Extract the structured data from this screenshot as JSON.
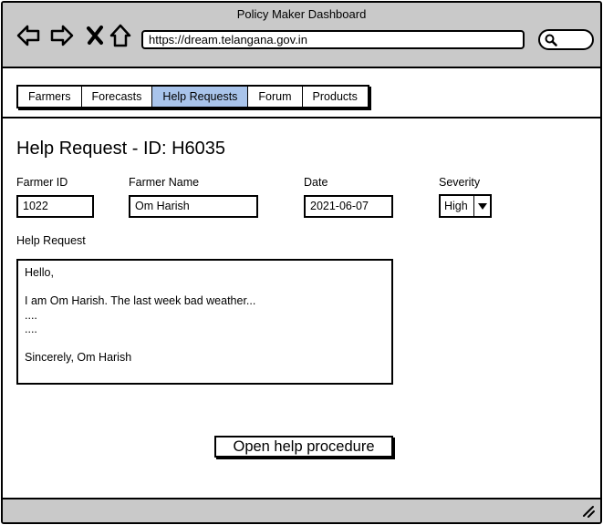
{
  "window": {
    "title": "Policy Maker Dashboard"
  },
  "browser": {
    "url": "https://dream.telangana.gov.in",
    "icons": [
      "back-arrow-icon",
      "forward-arrow-icon",
      "close-icon",
      "home-icon",
      "search-icon"
    ]
  },
  "tabs": [
    {
      "label": "Farmers",
      "active": false
    },
    {
      "label": "Forecasts",
      "active": false
    },
    {
      "label": "Help Requests",
      "active": true
    },
    {
      "label": "Forum",
      "active": false
    },
    {
      "label": "Products",
      "active": false
    }
  ],
  "page": {
    "title": "Help Request - ID: H6035"
  },
  "form": {
    "farmer_id": {
      "label": "Farmer ID",
      "value": "1022"
    },
    "farmer_name": {
      "label": "Farmer Name",
      "value": "Om Harish"
    },
    "date": {
      "label": "Date",
      "value": "2021-06-07"
    },
    "severity": {
      "label": "Severity",
      "value": "High"
    },
    "help_request": {
      "label": "Help Request",
      "lines": [
        "Hello,",
        "",
        "I am Om Harish. The last week bad weather...",
        "....",
        "....",
        "",
        "Sincerely, Om Harish"
      ]
    }
  },
  "actions": {
    "open_procedure": "Open help procedure"
  },
  "colors": {
    "chrome": "#c9c9c9",
    "active_tab": "#a9c4eb"
  }
}
